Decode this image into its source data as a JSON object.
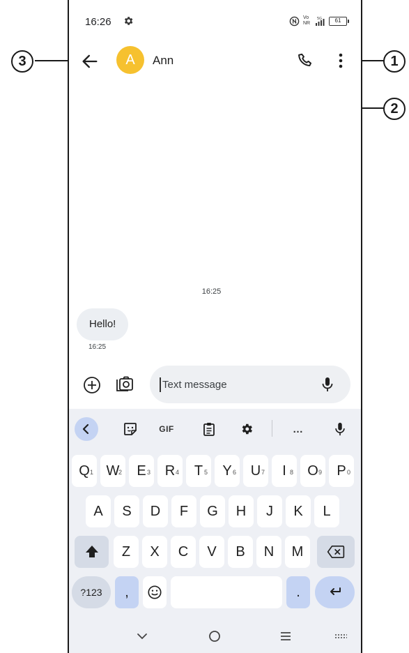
{
  "status_bar": {
    "time": "16:26",
    "network_top": "Vo",
    "network_bottom": "NR",
    "network_badge": "5G",
    "battery": "61",
    "battery_level": 0.61
  },
  "app_bar": {
    "avatar_letter": "A",
    "avatar_color": "#f6c12f",
    "contact_name": "Ann",
    "icons": [
      "back-arrow-icon",
      "phone-call-icon",
      "more-vert-icon"
    ]
  },
  "conversation": {
    "timestamp": "16:25",
    "messages": [
      {
        "text": "Hello!",
        "time": "16:25"
      }
    ]
  },
  "compose": {
    "placeholder": "Text message"
  },
  "keyboard": {
    "toolbar": {
      "gif_label": "GIF",
      "more_label": "…"
    },
    "row1": [
      "Q",
      "W",
      "E",
      "R",
      "T",
      "Y",
      "U",
      "I",
      "O",
      "P"
    ],
    "row1_hints": [
      "1",
      "2",
      "3",
      "4",
      "5",
      "6",
      "7",
      "8",
      "9",
      "0"
    ],
    "row2": [
      "A",
      "S",
      "D",
      "F",
      "G",
      "H",
      "J",
      "K",
      "L"
    ],
    "row3": [
      "Z",
      "X",
      "C",
      "V",
      "B",
      "N",
      "M"
    ],
    "symbols_label": "?123",
    "comma_label": ",",
    "period_label": "."
  },
  "callouts": {
    "one": "1",
    "two": "2",
    "three": "3"
  },
  "colors": {
    "accent": "#c4d3f3",
    "bubble": "#eceff3",
    "keyboard_bg": "#eef0f5"
  }
}
